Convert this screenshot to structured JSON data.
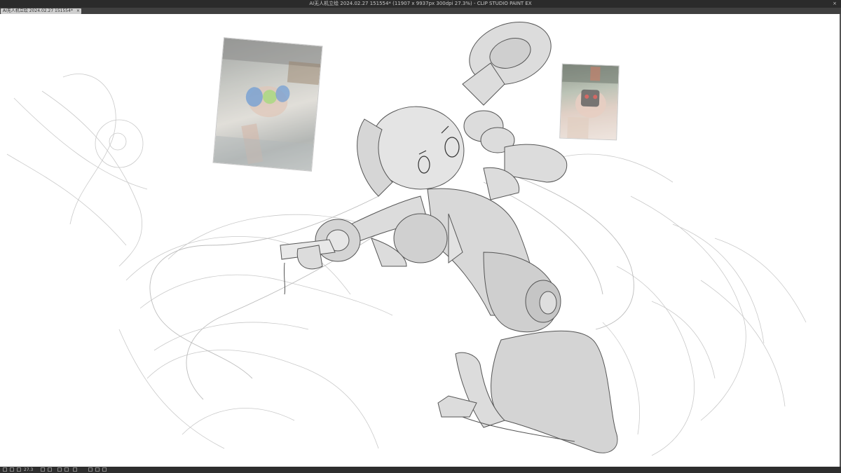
{
  "window": {
    "title": "AI无人机立绘 2024.02.27 151554* (11907 x 9937px 300dpi 27.3%) - CLIP STUDIO PAINT EX",
    "close_glyph": "×"
  },
  "tabs": [
    {
      "label": "AI无人机立绘 2024.02.27 151554*",
      "close_glyph": "×"
    }
  ],
  "status": {
    "zoom": "27.3"
  }
}
